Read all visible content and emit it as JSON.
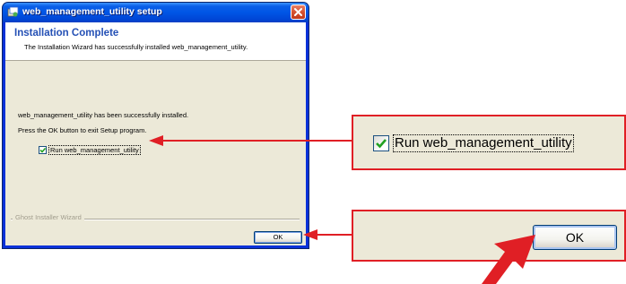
{
  "window": {
    "title": "web_management_utility setup",
    "close_icon": "close-icon"
  },
  "header": {
    "title": "Installation Complete",
    "subtitle": "The Installation Wizard has successfully installed web_management_utility."
  },
  "body": {
    "line1": "web_management_utility has been successfully installed.",
    "line2": "Press the OK button to exit Setup program.",
    "checkbox_label": "Run web_management_utility",
    "checkbox_checked": true
  },
  "footer": {
    "group_label": "Ghost Installer Wizard",
    "ok_label": "OK"
  },
  "callouts": {
    "checkbox_label": "Run web_management_utility",
    "ok_label": "OK"
  },
  "colors": {
    "accent_red": "#e01f25",
    "title_blue": "#0055e5",
    "header_title_blue": "#2450b5",
    "dialog_bg": "#ece9d8",
    "check_green": "#21a121"
  }
}
